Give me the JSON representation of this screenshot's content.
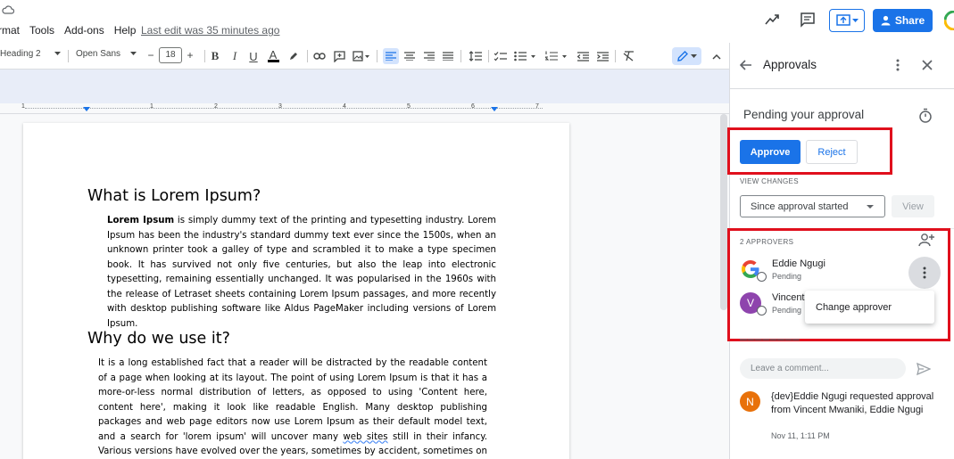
{
  "menubar": {
    "items": [
      "rmat",
      "Tools",
      "Add-ons",
      "Help"
    ],
    "last_edit": "Last edit was 35 minutes ago",
    "share_label": "Share"
  },
  "toolbar": {
    "style": "Heading 2",
    "font": "Open Sans",
    "font_size": "18",
    "minus": "−",
    "plus": "+"
  },
  "ruler": {
    "numbers": [
      "1",
      "1",
      "2",
      "3",
      "4",
      "5",
      "6",
      "7"
    ]
  },
  "document": {
    "heading1": "What is Lorem Ipsum?",
    "para1_bold": "Lorem Ipsum",
    "para1_rest": " is simply dummy text of the printing and typesetting industry. Lorem Ipsum has been the industry's standard dummy text ever since the 1500s, when an unknown printer took a galley of type and scrambled it to make a type specimen book. It has survived not only five centuries, but also the leap into electronic typesetting, remaining essentially unchanged. It was popularised in the 1960s with the release of Letraset sheets containing Lorem Ipsum passages, and more recently with desktop publishing software like Aldus PageMaker including versions of Lorem Ipsum.",
    "heading2": "Why do we use it?",
    "para2_a": "It is a long established fact that a reader will be distracted by the readable content of a page when looking at its layout. The point of using Lorem Ipsum is that it has a more-or-less normal distribution of letters, as opposed to using 'Content here, content here', making it look like readable English. Many desktop publishing packages and web page editors now use Lorem Ipsum as their default model text, and a search for 'lorem ipsum' will uncover many ",
    "para2_link": "web sites",
    "para2_b": " still in their infancy. Various versions have evolved over the years, sometimes by accident, sometimes on purpose (injected humour and the like)."
  },
  "panel": {
    "title": "Approvals",
    "pending_title": "Pending your approval",
    "approve_label": "Approve",
    "reject_label": "Reject",
    "view_changes_label": "VIEW CHANGES",
    "since_select": "Since approval started",
    "view_label": "View",
    "approvers_label": "2 APPROVERS",
    "approvers": [
      {
        "name": "Eddie Ngugi",
        "status": "Pending",
        "avatar": "G"
      },
      {
        "name": "Vincent",
        "status": "Pending",
        "avatar": "V"
      }
    ],
    "popup_item": "Change approver",
    "comment_placeholder": "Leave a comment...",
    "activity": {
      "avatar": "N",
      "text": "{dev}Eddie Ngugi requested approval from Vincent Mwaniki, Eddie Ngugi",
      "time": "Nov 11, 1:11 PM"
    }
  },
  "colors": {
    "accent": "#1a73e8",
    "highlight_box": "#e0101d",
    "vincent_avatar": "#8e44ad",
    "activity_avatar": "#e8710a"
  }
}
